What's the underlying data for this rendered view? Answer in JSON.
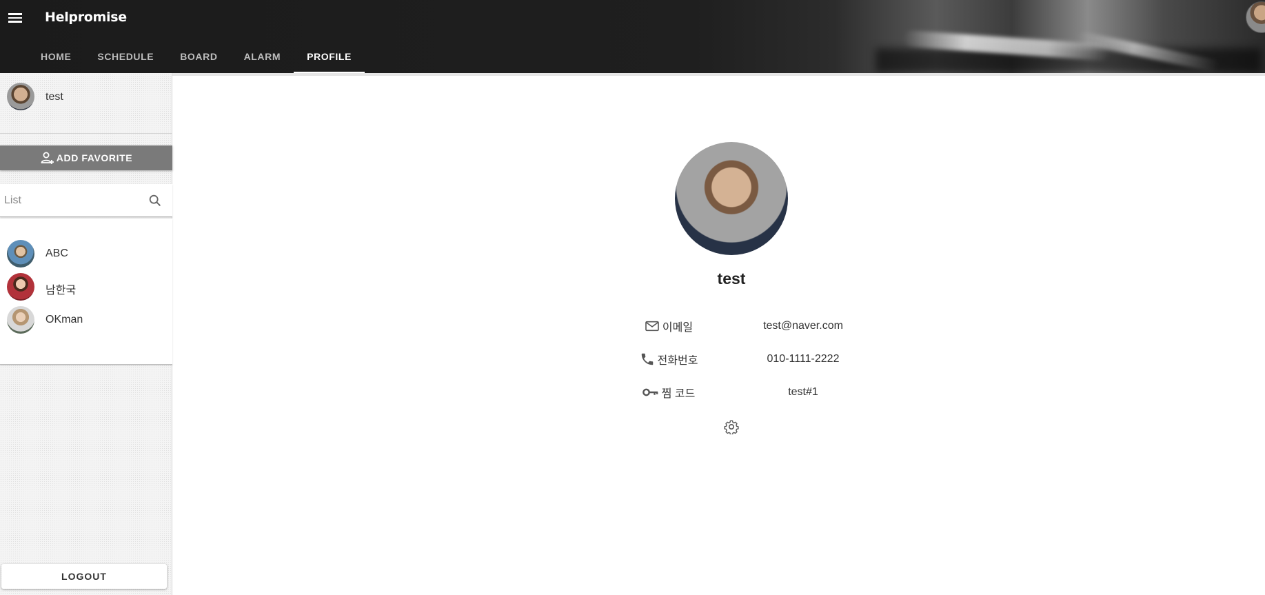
{
  "app": {
    "brand": "Helpromise"
  },
  "header": {
    "icons": {
      "menu": "menu-icon",
      "avatar": "user-avatar"
    },
    "tabs": [
      {
        "label": "HOME",
        "active": false
      },
      {
        "label": "SCHEDULE",
        "active": false
      },
      {
        "label": "BOARD",
        "active": false
      },
      {
        "label": "ALARM",
        "active": false
      },
      {
        "label": "PROFILE",
        "active": true
      }
    ]
  },
  "sidebar": {
    "me": {
      "name": "test"
    },
    "add_favorite_label": "ADD FAVORITE",
    "search": {
      "placeholder": "List",
      "value": ""
    },
    "friends": [
      {
        "name": "ABC"
      },
      {
        "name": "남한국"
      },
      {
        "name": "OKman"
      }
    ],
    "logout_label": "LOGOUT"
  },
  "profile": {
    "name": "test",
    "fields": [
      {
        "icon": "mail-icon",
        "label": "이메일",
        "value": "test@naver.com"
      },
      {
        "icon": "phone-icon",
        "label": "전화번호",
        "value": "010-1111-2222"
      },
      {
        "icon": "key-icon",
        "label": "찜 코드",
        "value": "test#1"
      }
    ],
    "settings_icon": "gear-icon"
  },
  "colors": {
    "header_bg": "#1b1b1b",
    "add_favorite_bg": "#7a7a7a",
    "sidebar_bg": "#f4f4f4",
    "tab_active": "#ffffff",
    "tab_inactive": "#bdbdbd"
  }
}
